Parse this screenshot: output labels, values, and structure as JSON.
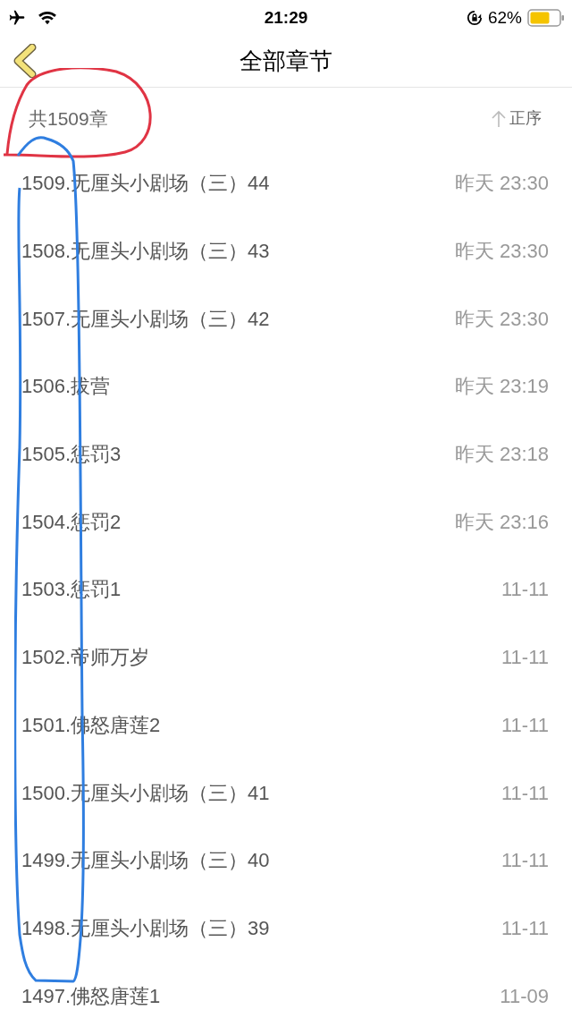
{
  "status_bar": {
    "time": "21:29",
    "battery": "62%"
  },
  "header": {
    "title": "全部章节"
  },
  "summary": {
    "count": "共1509章",
    "sort": "正序"
  },
  "chapters": [
    {
      "title": "1509.无厘头小剧场（三）44",
      "time": "昨天 23:30"
    },
    {
      "title": "1508.无厘头小剧场（三）43",
      "time": "昨天 23:30"
    },
    {
      "title": "1507.无厘头小剧场（三）42",
      "time": "昨天 23:30"
    },
    {
      "title": "1506.拔营",
      "time": "昨天 23:19"
    },
    {
      "title": "1505.惩罚3",
      "time": "昨天 23:18"
    },
    {
      "title": "1504.惩罚2",
      "time": "昨天 23:16"
    },
    {
      "title": "1503.惩罚1",
      "time": "11-11"
    },
    {
      "title": "1502.帝师万岁",
      "time": "11-11"
    },
    {
      "title": "1501.佛怒唐莲2",
      "time": "11-11"
    },
    {
      "title": "1500.无厘头小剧场（三）41",
      "time": "11-11"
    },
    {
      "title": "1499.无厘头小剧场（三）40",
      "time": "11-11"
    },
    {
      "title": "1498.无厘头小剧场（三）39",
      "time": "11-11"
    },
    {
      "title": "1497.佛怒唐莲1",
      "time": "11-09"
    }
  ]
}
